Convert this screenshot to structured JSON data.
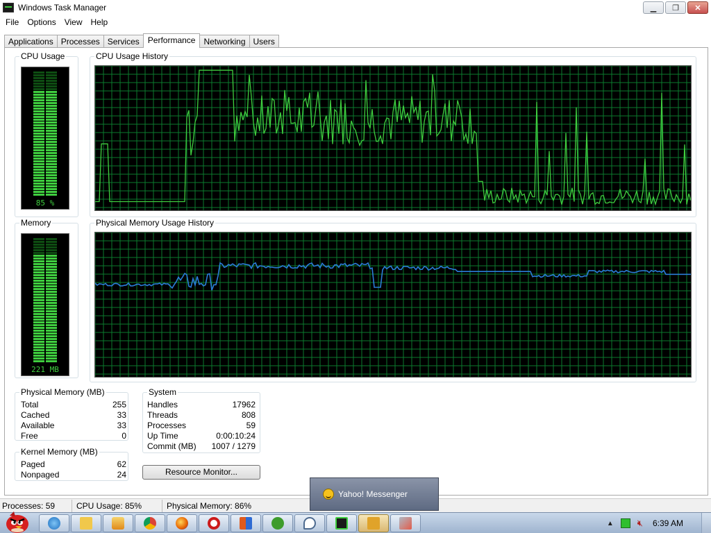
{
  "window": {
    "title": "Windows Task Manager",
    "controls": {
      "minimize": "▁",
      "maximize": "❐",
      "close": "✕"
    }
  },
  "menu": [
    "File",
    "Options",
    "View",
    "Help"
  ],
  "tabs": [
    "Applications",
    "Processes",
    "Services",
    "Performance",
    "Networking",
    "Users"
  ],
  "active_tab": "Performance",
  "cpu_usage": {
    "label": "CPU Usage",
    "value_text": "85 %",
    "level": 0.85
  },
  "cpu_history": {
    "label": "CPU Usage History"
  },
  "memory": {
    "label": "Memory",
    "value_text": "221 MB",
    "level": 0.86
  },
  "memory_history": {
    "label": "Physical Memory Usage History"
  },
  "physical_memory": {
    "title": "Physical Memory (MB)",
    "rows": [
      {
        "name": "Total",
        "value": "255"
      },
      {
        "name": "Cached",
        "value": "33"
      },
      {
        "name": "Available",
        "value": "33"
      },
      {
        "name": "Free",
        "value": "0"
      }
    ]
  },
  "kernel_memory": {
    "title": "Kernel Memory (MB)",
    "rows": [
      {
        "name": "Paged",
        "value": "62"
      },
      {
        "name": "Nonpaged",
        "value": "24"
      }
    ]
  },
  "system": {
    "title": "System",
    "rows": [
      {
        "name": "Handles",
        "value": "17962"
      },
      {
        "name": "Threads",
        "value": "808"
      },
      {
        "name": "Processes",
        "value": "59"
      },
      {
        "name": "Up Time",
        "value": "0:00:10:24"
      },
      {
        "name": "Commit (MB)",
        "value": "1007 / 1279"
      }
    ]
  },
  "resource_monitor_button": "Resource Monitor...",
  "statusbar": {
    "processes": "Processes: 59",
    "cpu": "CPU Usage: 85%",
    "memory": "Physical Memory: 86%"
  },
  "popup": {
    "text": "Yahoo! Messenger"
  },
  "taskbar": {
    "clock": "6:39 AM",
    "apps": [
      "internet-explorer-icon",
      "folder-icon",
      "media-player-icon",
      "chrome-icon",
      "firefox-icon",
      "opera-icon",
      "office-icon",
      "utorrent-icon",
      "chat-icon",
      "task-manager-icon",
      "yahoo-messenger-icon",
      "tool-icon"
    ]
  },
  "colors": {
    "graph_green": "#3fce3f",
    "grid_green": "#0b7a2e",
    "memory_line": "#2b7dd8"
  }
}
